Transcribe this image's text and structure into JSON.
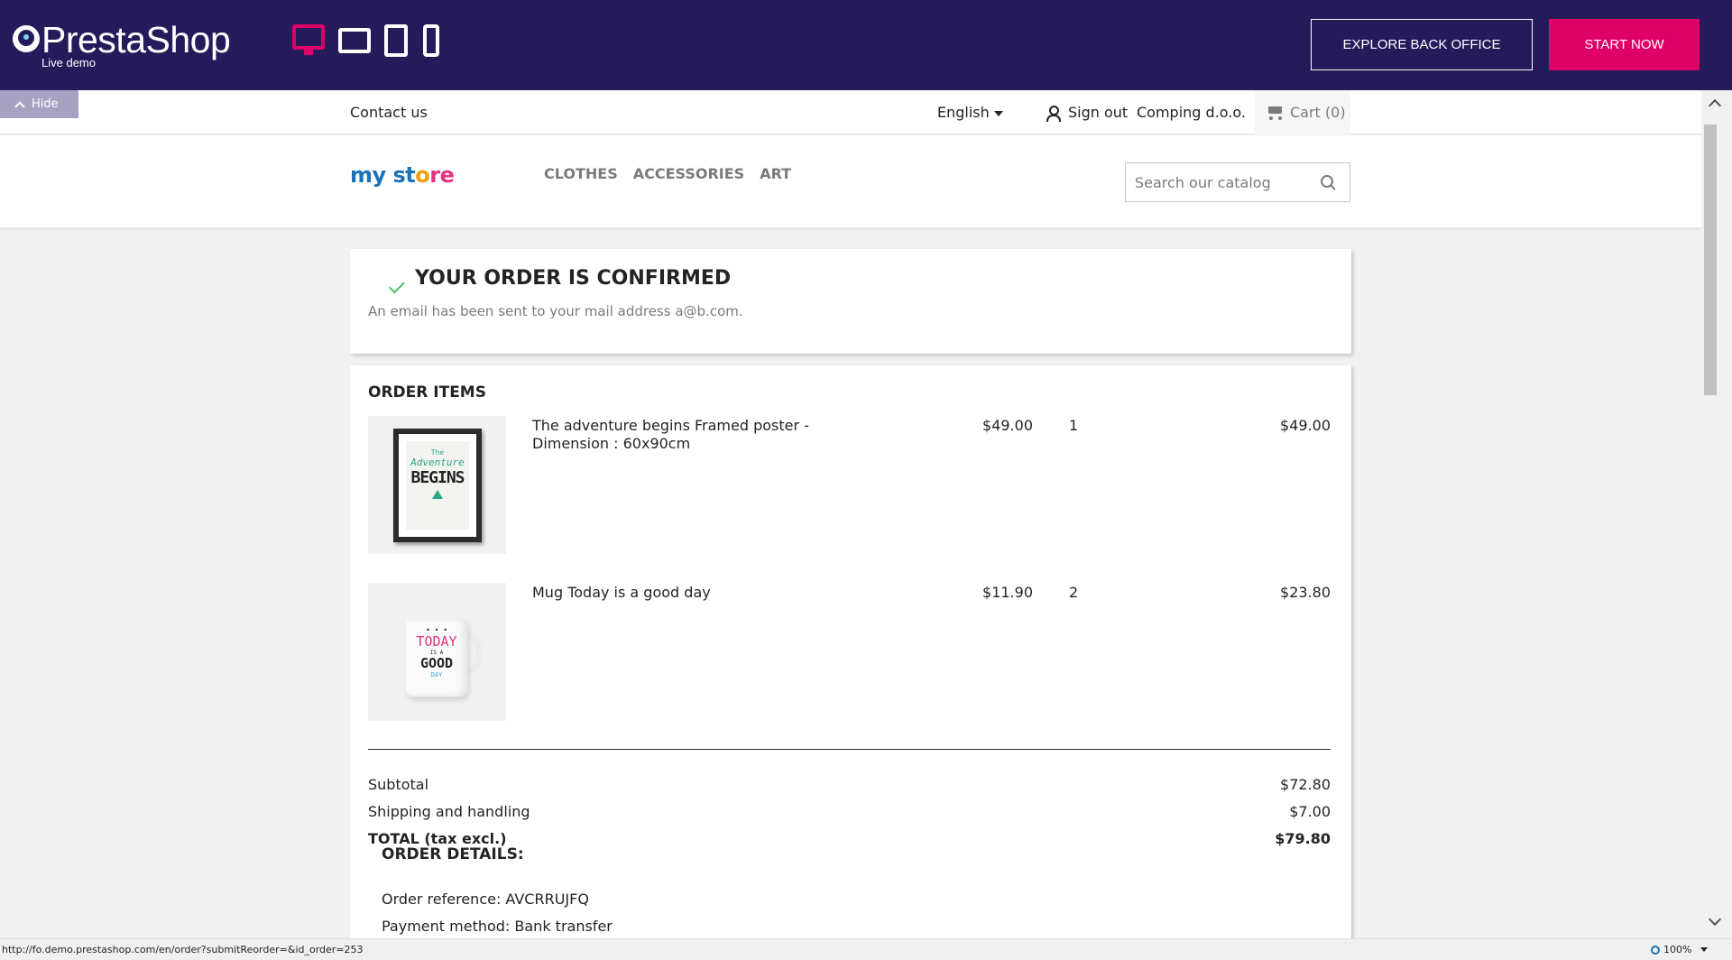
{
  "demo_bar": {
    "brand": "PrestaShop",
    "brand_sub": "Live demo",
    "devices": [
      "desktop-icon",
      "tablet-landscape-icon",
      "tablet-portrait-icon",
      "mobile-icon"
    ],
    "explore_label": "EXPLORE BACK OFFICE",
    "start_label": "START NOW",
    "accent_color": "#df0067",
    "bar_color": "#251b5b"
  },
  "hide_label": "Hide",
  "nav": {
    "contact": "Contact us",
    "language": "English",
    "signout": "Sign out",
    "company": "Comping d.o.o.",
    "cart": "Cart (0)"
  },
  "header": {
    "logo_parts": [
      "my ",
      "st",
      "o",
      "re"
    ],
    "menu": [
      "CLOTHES",
      "ACCESSORIES",
      "ART"
    ],
    "search_placeholder": "Search our catalog"
  },
  "confirmation": {
    "title": "YOUR ORDER IS CONFIRMED",
    "subtitle": "An email has been sent to your mail address a@b.com."
  },
  "order": {
    "title": "ORDER ITEMS",
    "items": [
      {
        "name": "The adventure begins Framed poster - Dimension : 60x90cm",
        "price": "$49.00",
        "qty": "1",
        "total": "$49.00",
        "image_text": [
          "The",
          "Adventure",
          "BEGINS"
        ]
      },
      {
        "name": "Mug Today is a good day",
        "price": "$11.90",
        "qty": "2",
        "total": "$23.80",
        "image_text": [
          "• • •",
          "TODAY",
          "IS A",
          "GOOD",
          "DAY"
        ]
      }
    ],
    "subtotal_label": "Subtotal",
    "subtotal": "$72.80",
    "shipping_label": "Shipping and handling",
    "shipping": "$7.00",
    "total_label": "TOTAL (tax excl.)",
    "total": "$79.80"
  },
  "details": {
    "title": "ORDER DETAILS:",
    "reference": "Order reference: AVCRRUJFQ",
    "payment": "Payment method: Bank transfer"
  },
  "statusbar": {
    "url": "http://fo.demo.prestashop.com/en/order?submitReorder=&id_order=253",
    "zoom": "100%"
  }
}
